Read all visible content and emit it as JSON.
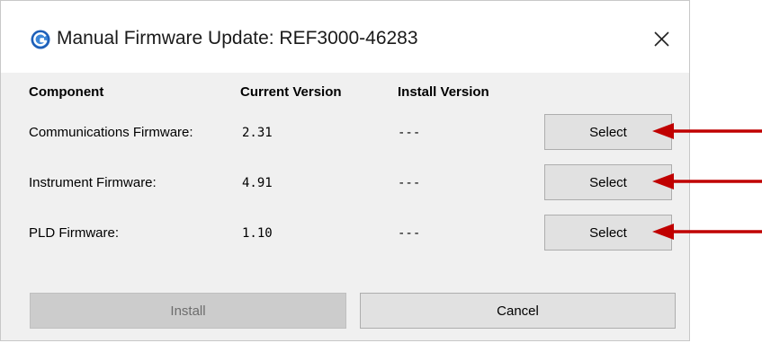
{
  "window": {
    "title": "Manual Firmware Update: REF3000-46283",
    "icon": "app-logo-icon",
    "close_icon": "close-icon"
  },
  "table": {
    "headers": [
      "Component",
      "Current Version",
      "Install Version"
    ],
    "rows": [
      {
        "component": "Communications Firmware:",
        "current": "2.31",
        "install": "---",
        "action": "Select"
      },
      {
        "component": "Instrument Firmware:",
        "current": "4.91",
        "install": "---",
        "action": "Select"
      },
      {
        "component": "PLD Firmware:",
        "current": "1.10",
        "install": "---",
        "action": "Select"
      }
    ]
  },
  "buttons": {
    "install": "Install",
    "install_enabled": false,
    "cancel": "Cancel"
  },
  "annotations": {
    "arrow_color": "#c00000",
    "arrow_icon": "arrow-left-icon"
  }
}
